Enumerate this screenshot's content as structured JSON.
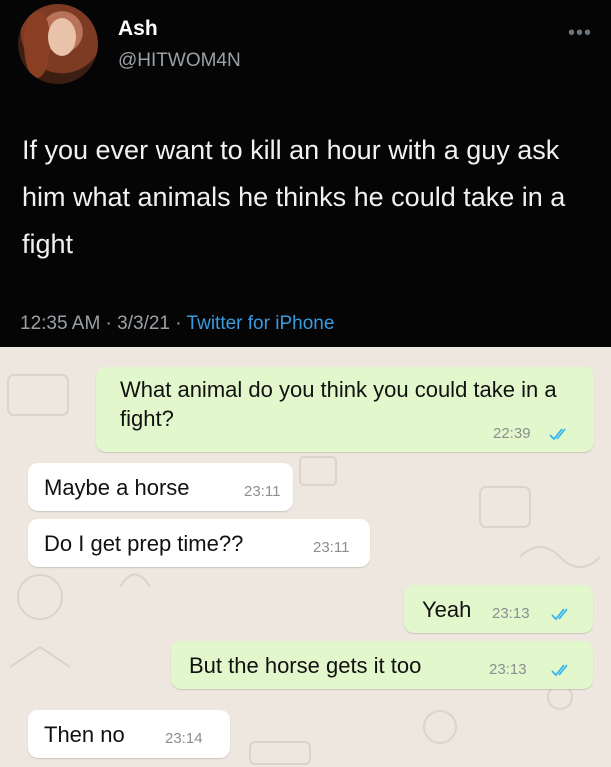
{
  "tweet": {
    "display_name": "Ash",
    "handle": "@HITWOM4N",
    "more_icon": "ellipsis-icon",
    "text": "If you ever want to kill an hour with a guy ask him what animals he thinks he could take in a fight",
    "time": "12:35 AM",
    "separator1": " · ",
    "date": "3/3/21",
    "separator2": " · ",
    "source": "Twitter for iPhone"
  },
  "chat": {
    "read_tick_color": "#34b7f1",
    "messages": [
      {
        "direction": "outgoing",
        "text": "What animal do you think you could take in a fight?",
        "time": "22:39",
        "status_icon": "double-check-icon"
      },
      {
        "direction": "incoming",
        "text": "Maybe a horse",
        "time": "23:11"
      },
      {
        "direction": "incoming",
        "text": "Do I get prep time??",
        "time": "23:11"
      },
      {
        "direction": "outgoing",
        "text": "Yeah",
        "time": "23:13",
        "status_icon": "double-check-icon"
      },
      {
        "direction": "outgoing",
        "text": "But the horse gets it too",
        "time": "23:13",
        "status_icon": "double-check-icon"
      },
      {
        "direction": "incoming",
        "text": "Then no",
        "time": "23:14"
      }
    ]
  }
}
